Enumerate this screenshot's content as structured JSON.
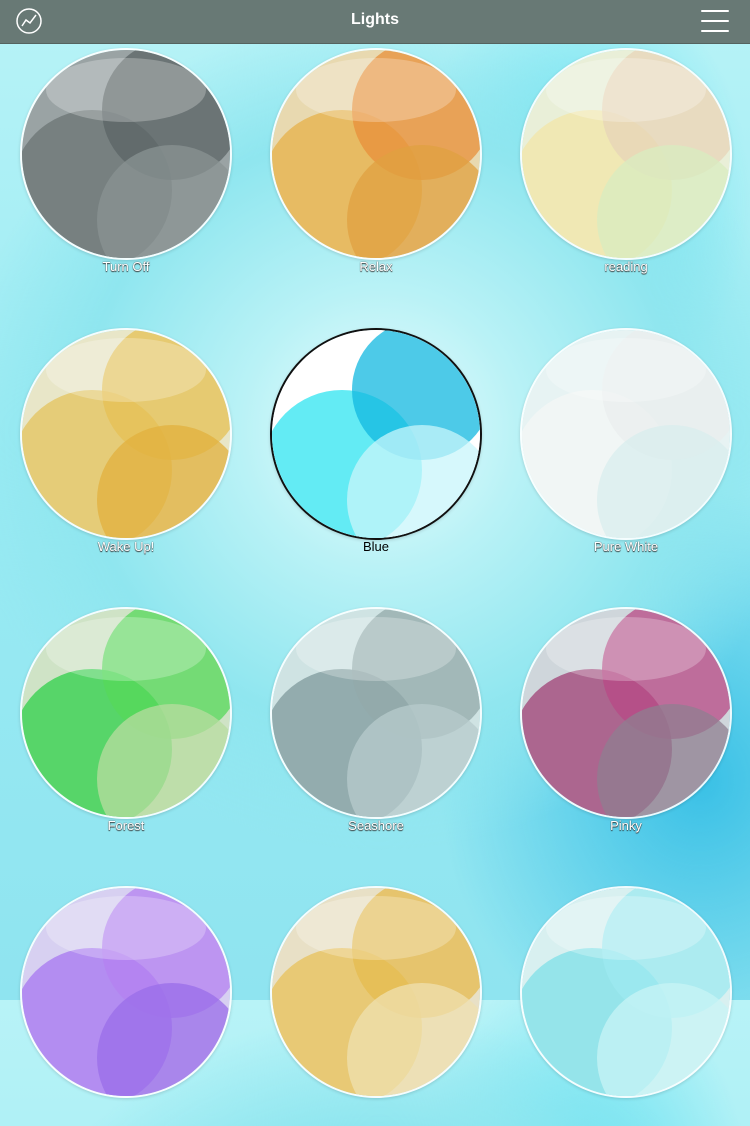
{
  "header": {
    "title": "Lights",
    "left_icon": "chart-trend-icon",
    "right_icon": "hamburger-menu-icon"
  },
  "scenes": [
    {
      "label": "Turn Off",
      "base": "#9aa3a4",
      "colors": [
        "#6b7474",
        "#5b6466",
        "#8a9393"
      ],
      "selected": false
    },
    {
      "label": "Relax",
      "base": "#e8d9b0",
      "colors": [
        "#e7b04a",
        "#e88f3a",
        "#e0a040"
      ],
      "selected": false
    },
    {
      "label": "reading",
      "base": "#e9efd8",
      "colors": [
        "#f1e6a8",
        "#e7d4b8",
        "#d8ecc0"
      ],
      "selected": false
    },
    {
      "label": "Wake Up!",
      "base": "#e8e6c8",
      "colors": [
        "#e4c35e",
        "#e6c054",
        "#e2b03e"
      ],
      "selected": false
    },
    {
      "label": "Blue",
      "base": "#ffffff",
      "colors": [
        "#2fe4f0",
        "#12b8e0",
        "#c8f6fb"
      ],
      "selected": true
    },
    {
      "label": "Pure White",
      "base": "#e7f3f3",
      "colors": [
        "#f4f7f6",
        "#e9eeed",
        "#d8eeee"
      ],
      "selected": false
    },
    {
      "label": "Forest",
      "base": "#cfe3c6",
      "colors": [
        "#2fd04a",
        "#55d85a",
        "#b8dca0"
      ],
      "selected": false
    },
    {
      "label": "Seashore",
      "base": "#cfe3e3",
      "colors": [
        "#7f9a9c",
        "#93a9aa",
        "#b7cbcc"
      ],
      "selected": false
    },
    {
      "label": "Pinky",
      "base": "#cfd6db",
      "colors": [
        "#a04075",
        "#b84a85",
        "#8f7f90"
      ],
      "selected": false
    },
    {
      "label": "",
      "base": "#d7d0f1",
      "colors": [
        "#a777f0",
        "#b482f0",
        "#9a6ee8"
      ],
      "selected": false
    },
    {
      "label": "",
      "base": "#e8e0c6",
      "colors": [
        "#e8c25a",
        "#e6bb4f",
        "#efe0b0"
      ],
      "selected": false
    },
    {
      "label": "",
      "base": "#d8f0f0",
      "colors": [
        "#7fe0e8",
        "#9eeaf0",
        "#c8f4f6"
      ],
      "selected": false
    }
  ]
}
